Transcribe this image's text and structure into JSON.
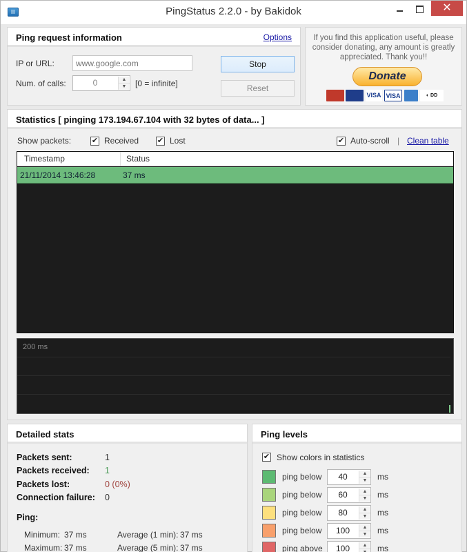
{
  "window": {
    "title": "PingStatus 2.2.0 - by Bakidok",
    "controls": {
      "minimize": "minimize",
      "maximize": "maximize",
      "close": "✕"
    }
  },
  "ping_request": {
    "title": "Ping request information",
    "options_link": "Options",
    "ip_label": "IP or URL:",
    "ip_value": "",
    "ip_placeholder": "www.google.com",
    "calls_label": "Num. of calls:",
    "calls_value": "0",
    "calls_hint": "[0 = infinite]",
    "stop_button": "Stop",
    "reset_button": "Reset"
  },
  "donate": {
    "message": "If you find this application useful, please consider donating, any amount is greatly appreciated. Thank you!!",
    "button": "Donate",
    "cards": [
      "MasterCard",
      "Maestro",
      "VISA",
      "VISA Electron",
      "American Express",
      "Direct Debit"
    ]
  },
  "statistics": {
    "title": "Statistics  [ pinging 173.194.67.104 with 32 bytes of data... ]",
    "show_packets_label": "Show packets:",
    "received_label": "Received",
    "received_checked": true,
    "lost_label": "Lost",
    "lost_checked": true,
    "autoscroll_label": "Auto-scroll",
    "autoscroll_checked": true,
    "separator": "|",
    "clean_table_link": "Clean table",
    "columns": [
      "Timestamp",
      "Status"
    ],
    "rows": [
      {
        "timestamp": "21/11/2014  13:46:28",
        "status": "37 ms",
        "color": "#6dbb7c"
      }
    ],
    "graph": {
      "max_label": "200 ms",
      "max_ms": 200,
      "samples_ms": [
        37
      ]
    }
  },
  "detailed_stats": {
    "title": "Detailed stats",
    "packets_sent_label": "Packets sent:",
    "packets_sent": "1",
    "packets_received_label": "Packets received:",
    "packets_received": "1",
    "packets_lost_label": "Packets lost:",
    "packets_lost": "0  (0%)",
    "connection_failure_label": "Connection failure:",
    "connection_failure": "0",
    "ping_label": "Ping:",
    "minimum_label": "Minimum:",
    "minimum": "37 ms",
    "avg1_label": "Average (1 min):",
    "avg1": "37 ms",
    "maximum_label": "Maximum:",
    "maximum": "37 ms",
    "avg5_label": "Average (5 min):",
    "avg5": "37 ms"
  },
  "ping_levels": {
    "title": "Ping levels",
    "show_colors_label": "Show colors in statistics",
    "show_colors_checked": true,
    "unit": "ms",
    "levels": [
      {
        "label": "ping below",
        "value": "40",
        "color": "#5dba72"
      },
      {
        "label": "ping below",
        "value": "60",
        "color": "#a9d57c"
      },
      {
        "label": "ping below",
        "value": "80",
        "color": "#fde07e"
      },
      {
        "label": "ping below",
        "value": "100",
        "color": "#f8a06c"
      },
      {
        "label": "ping above",
        "value": "100",
        "color": "#e06666"
      }
    ]
  }
}
